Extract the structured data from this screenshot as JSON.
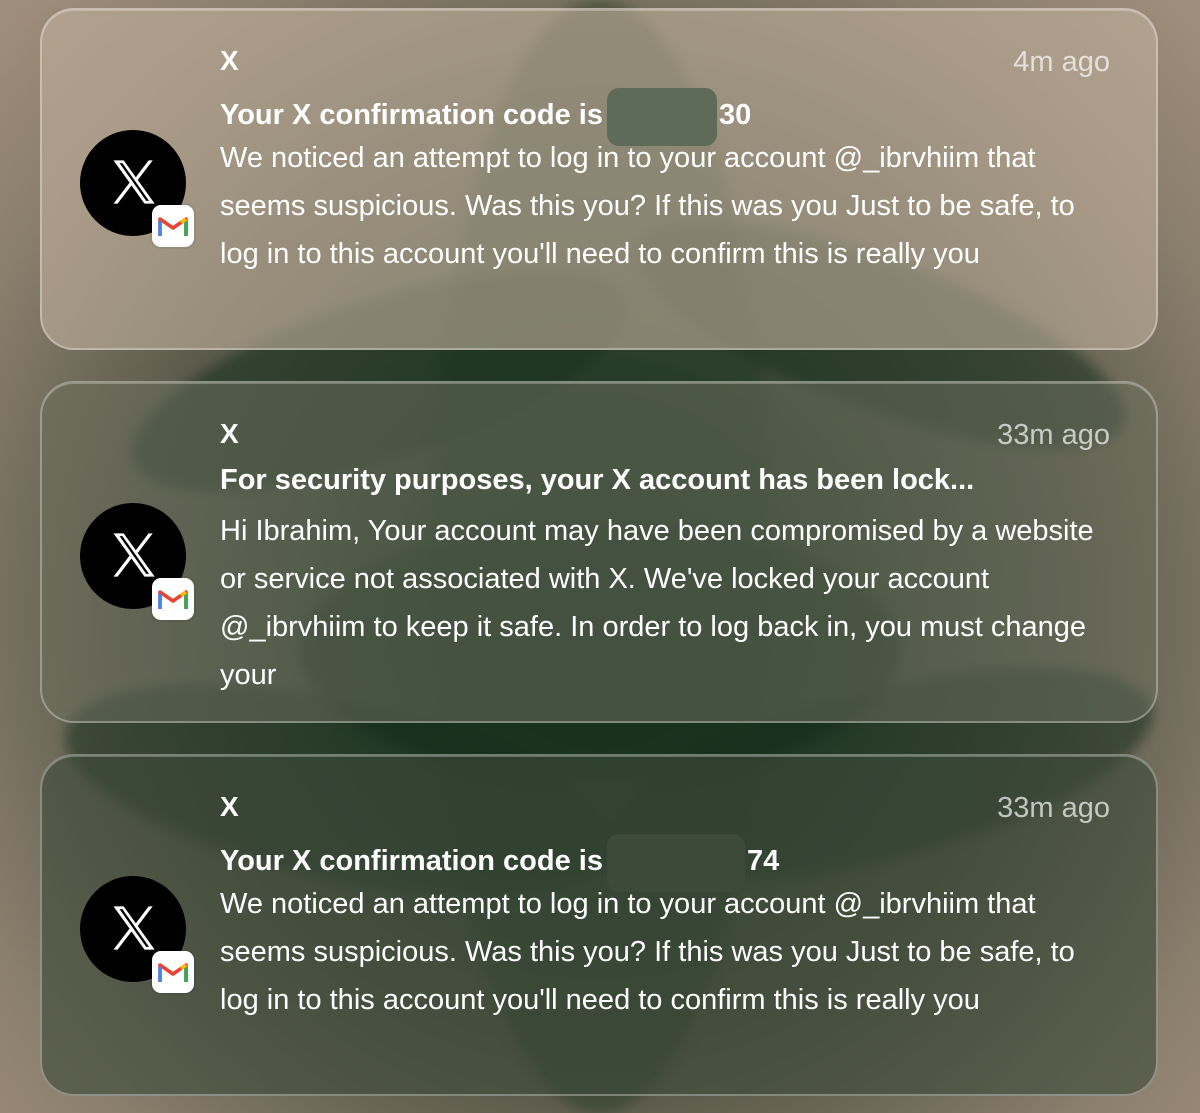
{
  "notifications": [
    {
      "app": "X",
      "time": "4m ago",
      "title_before": "Your X confirmation code is",
      "title_after": "30",
      "body": "We noticed an attempt to log in to your account @_ibrvhiim that seems suspicious. Was this you? If this was you Just to be safe, to log in to this account you'll need to confirm this is really you",
      "icon": "x-logo-icon",
      "badge_icon": "gmail-icon"
    },
    {
      "app": "X",
      "time": "33m ago",
      "title_before": "For security purposes, your X account has been lock...",
      "title_after": "",
      "body": "Hi Ibrahim, Your account may have been compromised by a website or service not associated with X. We've locked your account @_ibrvhiim to keep it safe. In order to log back in, you must change your",
      "icon": "x-logo-icon",
      "badge_icon": "gmail-icon"
    },
    {
      "app": "X",
      "time": "33m ago",
      "title_before": "Your X confirmation code is",
      "title_after": "74",
      "body": "We noticed an attempt to log in to your account @_ibrvhiim that seems suspicious. Was this you? If this was you Just to be safe, to log in to this account you'll need to confirm this is really you",
      "icon": "x-logo-icon",
      "badge_icon": "gmail-icon"
    }
  ],
  "colors": {
    "gmail_red": "#EA4335",
    "gmail_blue": "#4285F4",
    "gmail_green": "#34A853",
    "gmail_yellow": "#FBBC04"
  }
}
